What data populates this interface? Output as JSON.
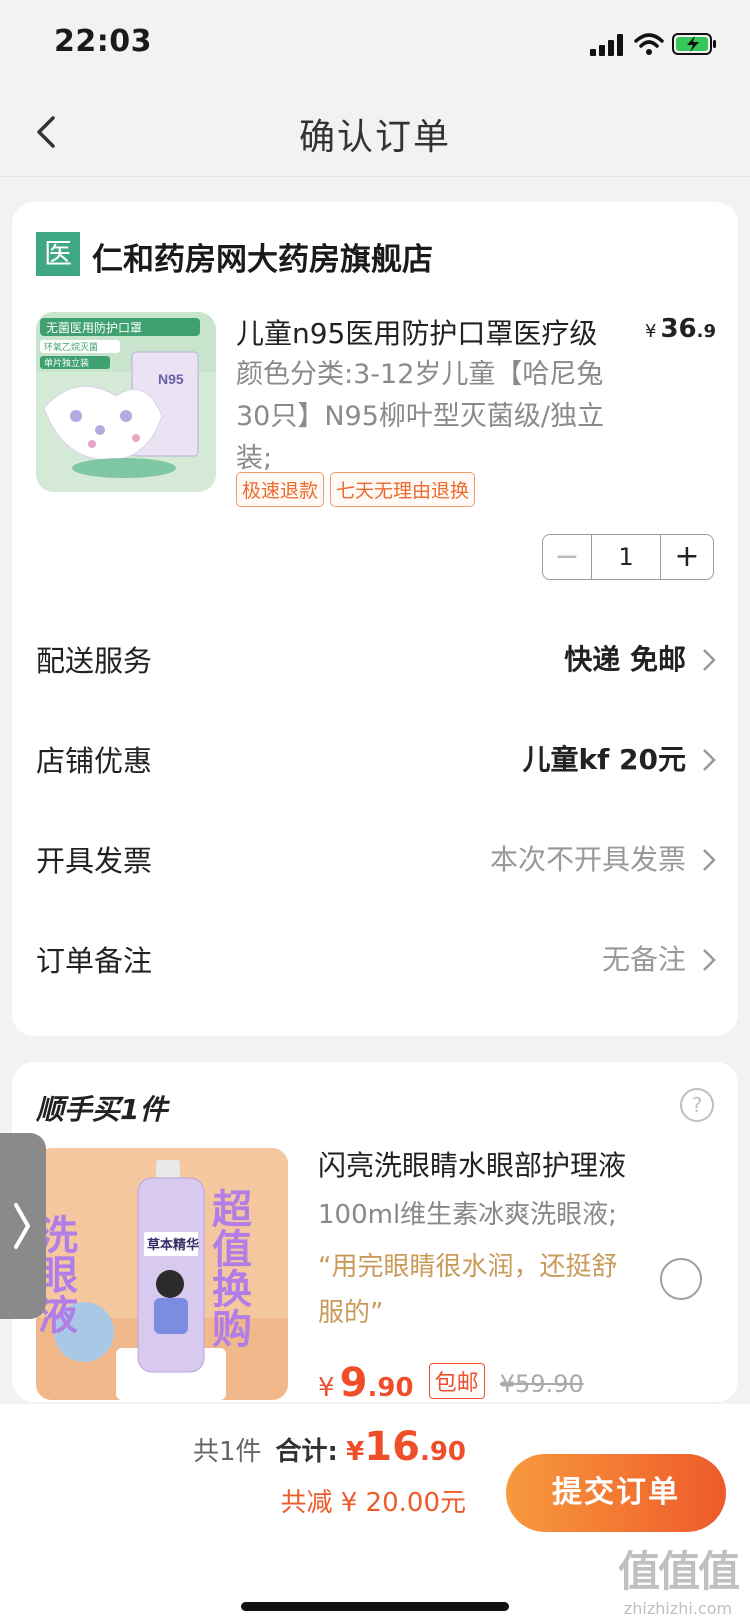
{
  "status_bar": {
    "time": "22:03"
  },
  "nav": {
    "title": "确认订单"
  },
  "shop": {
    "logo_char": "医",
    "name": "仁和药房网大药房旗舰店",
    "product": {
      "title": "儿童n95医用防护口罩医疗级",
      "sku": "颜色分类:3-12岁儿童【哈尼兔30只】N95柳叶型灭菌级/独立装;",
      "price_currency": "¥",
      "price_int": "36",
      "price_dec": ".9",
      "tags": [
        "极速退款",
        "七天无理由退换"
      ],
      "quantity": "1",
      "image_texts": [
        "无菌医用防护口罩",
        "环氧乙烷灭菌",
        "单片独立装",
        "N95"
      ]
    },
    "rows": [
      {
        "label": "配送服务",
        "value": "快递 免邮"
      },
      {
        "label": "店铺优惠",
        "value": "儿童kf 20元"
      },
      {
        "label": "开具发票",
        "value": "本次不开具发票"
      },
      {
        "label": "订单备注",
        "value": "无备注"
      }
    ]
  },
  "addon": {
    "title": "顺手买1件",
    "help": "?",
    "name": "闪亮洗眼睛水眼部护理液",
    "sku": "100ml维生素冰爽洗眼液;",
    "quote": "“用完眼睛很水润，还挺舒服的”",
    "price_currency": "¥",
    "price_int": "9",
    "price_dec": ".90",
    "free_ship": "包邮",
    "original_price": "¥59.90",
    "image_texts": {
      "left": "洗眼液",
      "right": "超值换购",
      "label": "草本精华"
    }
  },
  "side_tab": {
    "glyph": "❯"
  },
  "bottom": {
    "count": "共1件",
    "total_label": "合计:",
    "total_currency": "¥",
    "total_int": "16",
    "total_dec": ".90",
    "discount": "共减 ¥ 20.00元",
    "submit": "提交订单"
  },
  "watermark": {
    "logo": "值值值",
    "text": "zhizhizhi.com"
  },
  "colors": {
    "accent": "#ee4e2a",
    "brand_green": "#3fa882",
    "button_start": "#f79a3d",
    "button_end": "#ee5a2a"
  }
}
